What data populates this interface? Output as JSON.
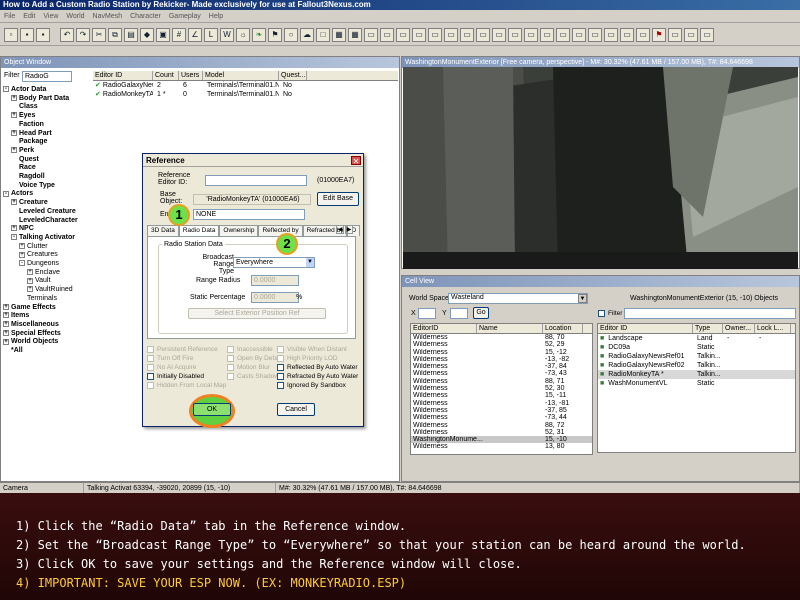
{
  "window_title": "How to Add a Custom Radio Station by Rekicker- Made exclusively for use at Fallout3Nexus.com",
  "menu": [
    "File",
    "Edit",
    "View",
    "World",
    "NavMesh",
    "Character",
    "Gameplay",
    "Help"
  ],
  "object_window": {
    "title": "Object Window",
    "filter_label": "Filter",
    "filter_value": "RadioG",
    "tree": [
      {
        "label": "Actor Data",
        "indent": 0,
        "exp": "-",
        "bold": true
      },
      {
        "label": "Body Part Data",
        "indent": 1,
        "exp": "+",
        "bold": true
      },
      {
        "label": "Class",
        "indent": 1,
        "exp": "",
        "bold": true
      },
      {
        "label": "Eyes",
        "indent": 1,
        "exp": "+",
        "bold": true
      },
      {
        "label": "Faction",
        "indent": 1,
        "exp": "",
        "bold": true
      },
      {
        "label": "Head Part",
        "indent": 1,
        "exp": "+",
        "bold": true
      },
      {
        "label": "Package",
        "indent": 1,
        "exp": "",
        "bold": true
      },
      {
        "label": "Perk",
        "indent": 1,
        "exp": "+",
        "bold": true
      },
      {
        "label": "Quest",
        "indent": 1,
        "exp": "",
        "bold": true
      },
      {
        "label": "Race",
        "indent": 1,
        "exp": "",
        "bold": true
      },
      {
        "label": "Ragdoll",
        "indent": 1,
        "exp": "",
        "bold": true
      },
      {
        "label": "Voice Type",
        "indent": 1,
        "exp": "",
        "bold": true
      },
      {
        "label": "Actors",
        "indent": 0,
        "exp": "-",
        "bold": true
      },
      {
        "label": "Creature",
        "indent": 1,
        "exp": "+",
        "bold": true
      },
      {
        "label": "Leveled Creature",
        "indent": 1,
        "exp": "",
        "bold": true
      },
      {
        "label": "LeveledCharacter",
        "indent": 1,
        "exp": "",
        "bold": true
      },
      {
        "label": "NPC",
        "indent": 1,
        "exp": "+",
        "bold": true
      },
      {
        "label": "Talking Activator",
        "indent": 1,
        "exp": "-",
        "bold": true
      },
      {
        "label": "Clutter",
        "indent": 2,
        "exp": "+",
        "bold": false
      },
      {
        "label": "Creatures",
        "indent": 2,
        "exp": "+",
        "bold": false
      },
      {
        "label": "Dungeons",
        "indent": 2,
        "exp": "-",
        "bold": false
      },
      {
        "label": "Enclave",
        "indent": 3,
        "exp": "+",
        "bold": false
      },
      {
        "label": "Vault",
        "indent": 3,
        "exp": "+",
        "bold": false
      },
      {
        "label": "VaultRuined",
        "indent": 3,
        "exp": "+",
        "bold": false
      },
      {
        "label": "Terminals",
        "indent": 2,
        "exp": "",
        "bold": false
      },
      {
        "label": "Game Effects",
        "indent": 0,
        "exp": "+",
        "bold": true
      },
      {
        "label": "Items",
        "indent": 0,
        "exp": "+",
        "bold": true
      },
      {
        "label": "Miscellaneous",
        "indent": 0,
        "exp": "+",
        "bold": true
      },
      {
        "label": "Special Effects",
        "indent": 0,
        "exp": "+",
        "bold": true
      },
      {
        "label": "World Objects",
        "indent": 0,
        "exp": "+",
        "bold": true
      },
      {
        "label": "*All",
        "indent": 0,
        "exp": "",
        "bold": true
      }
    ],
    "columns": [
      "Editor ID",
      "Count",
      "Users",
      "Model",
      "Quest..."
    ],
    "rows": [
      [
        "RadioGalaxyNews",
        "2",
        "6",
        "Terminals\\Terminal01.NIF",
        "No"
      ],
      [
        "RadioMonkeyTA",
        "1 *",
        "0",
        "Terminals\\Terminal01.NIF",
        "No"
      ]
    ]
  },
  "render_window": {
    "title": "WashingtonMonumentExterior [Free camera, perspective] - M#: 30.32% (47.61 MB / 157.00 MB), T#: 84.646698"
  },
  "cell_view": {
    "title": "Cell View",
    "world_space_label": "World Space",
    "world_space_value": "Wasteland",
    "location_text": "WashingtonMonumentExterior (15, -10) Objects",
    "x_label": "X",
    "y_label": "Y",
    "go_label": "Go",
    "filter_label": "Filter",
    "cell_columns": [
      "EditorID",
      "Name",
      "Location"
    ],
    "cells": [
      [
        "Wilderness",
        "88, 70"
      ],
      [
        "Wilderness",
        "52, 29"
      ],
      [
        "Wilderness",
        "15, -12"
      ],
      [
        "Wilderness",
        "-13, -82"
      ],
      [
        "Wilderness",
        "-37, 84"
      ],
      [
        "Wilderness",
        "-73, 43"
      ],
      [
        "Wilderness",
        "88, 71"
      ],
      [
        "Wilderness",
        "52, 30"
      ],
      [
        "Wilderness",
        "15, -11"
      ],
      [
        "Wilderness",
        "-13, -81"
      ],
      [
        "Wilderness",
        "-37, 85"
      ],
      [
        "Wilderness",
        "-73, 44"
      ],
      [
        "Wilderness",
        "88, 72"
      ],
      [
        "Wilderness",
        "52, 31"
      ],
      [
        "WashingtonMonume...",
        "15, -10"
      ],
      [
        "Wilderness",
        "13, 80"
      ]
    ],
    "obj_columns": [
      "Editor ID",
      "Type",
      "Owner...",
      "Lock L..."
    ],
    "objects": [
      [
        "Landscape",
        "Land",
        "-",
        "-"
      ],
      [
        "DC09a",
        "Static",
        "",
        ""
      ],
      [
        "RadioGalaxyNewsRef01",
        "Talkin...",
        "",
        ""
      ],
      [
        "RadioGalaxyNewsRef02",
        "Talkin...",
        "",
        ""
      ],
      [
        "RadioMonkeyTA *",
        "Talkin...",
        "",
        ""
      ],
      [
        "WashMonumentVL",
        "Static",
        "",
        ""
      ]
    ]
  },
  "status": [
    "Camera",
    "Talking Activat 63394, -39020, 20899 (15, -10)",
    "M#: 30.32% (47.61 MB / 157.00 MB), T#: 84.646698"
  ],
  "reference_dialog": {
    "title": "Reference",
    "editor_id_label": "Reference Editor ID:",
    "form_id": "(01000EA7)",
    "base_object_label": "Base Object:",
    "base_object_value": "'RadioMonkeyTA' (01000EA6)",
    "edit_base": "Edit Base",
    "enable_parent_label": "En",
    "enable_parent_value": "NONE",
    "tabs": [
      "3D Data",
      "Radio Data",
      "Ownership",
      "Reflected by",
      "Refracted by",
      "D"
    ],
    "group_title": "Radio Station Data",
    "broadcast_label": "Broadcast Range Type",
    "broadcast_value": "Everywhere",
    "range_radius_label": "Range Radius",
    "range_radius_value": "0.0000",
    "static_pct_label": "Static Percentage",
    "static_pct_value": "0.0000",
    "pct_sign": "%",
    "select_btn": "Select Exterior Position Ref",
    "checks_col1": [
      "Persistent Reference",
      "Turn Off Fire",
      "No AI Acquire",
      "Initially Disabled",
      "Hidden From Local Map"
    ],
    "checks_col2": [
      "Inaccessible",
      "Open By Default",
      "Motion Blur",
      "Casts Shadows"
    ],
    "checks_col3": [
      "Visible When Distant",
      "High Priority LOD",
      "Reflected By Auto Water",
      "Refracted By Auto Water",
      "Ignored By Sandbox"
    ],
    "ok": "OK",
    "cancel": "Cancel",
    "marker1": "1",
    "marker2": "2"
  },
  "instructions": [
    "1) Click the “Radio Data” tab in the Reference window.",
    "2) Set the “Broadcast Range Type” to “Everywhere” so that your station can be heard around the world.",
    "3) Click OK to save your settings and the Reference window will close.",
    "4) IMPORTANT: SAVE YOUR ESP NOW. (EX: MONKEYRADIO.ESP)"
  ]
}
